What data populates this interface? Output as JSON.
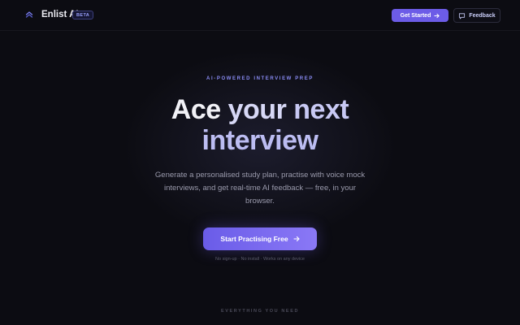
{
  "nav": {
    "brand": "Enlist AI",
    "badge": "BETA",
    "get_started_label": "Get Started",
    "feedback_label": "Feedback"
  },
  "hero": {
    "eyebrow": "AI-POWERED INTERVIEW PREP",
    "title_words": [
      "Ace",
      "your",
      "next",
      "interview"
    ],
    "description": "Generate a personalised study plan, practise with voice mock interviews, and get real-time AI feedback — free, in your browser.",
    "cta_label": "Start Practising Free",
    "fine_print": "No sign-up · No install · Works on any device"
  },
  "section": {
    "label": "EVERYTHING YOU NEED"
  },
  "icons": {
    "logo": "double-chevron-up-icon",
    "get_started": "arrow-right-icon",
    "feedback": "chat-bubble-icon",
    "cta": "arrow-right-icon"
  },
  "colors": {
    "background": "#0c0c12",
    "accent": "#6c5ce7",
    "accent_light": "#8a78f6",
    "eyebrow": "#8a8cf5"
  }
}
